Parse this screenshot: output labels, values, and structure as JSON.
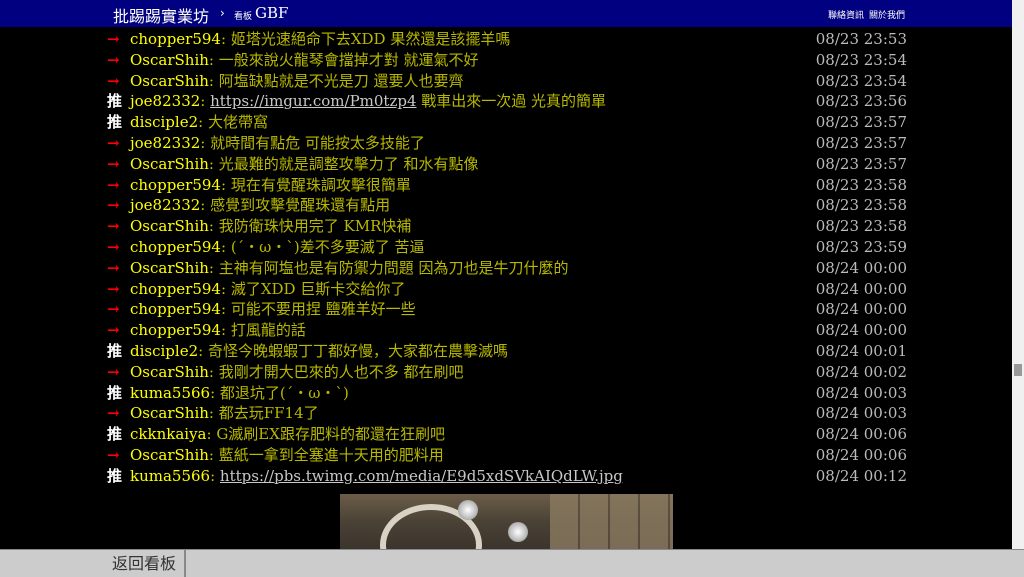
{
  "header": {
    "site_title": "批踢踢實業坊",
    "separator": "›",
    "board_prefix": "看板",
    "board_name": "GBF",
    "contact_link": "聯絡資訊",
    "about_link": "關於我們"
  },
  "pushes": [
    {
      "tag": "→",
      "type": "arrow",
      "user": "chopper594",
      "content": "姬塔光速絕命下去XDD 果然還是該擺羊嗎",
      "time": "08/23 23:53"
    },
    {
      "tag": "→",
      "type": "arrow",
      "user": "OscarShih",
      "content": "一般來說火龍琴會擋掉才對 就運氣不好",
      "time": "08/23 23:54"
    },
    {
      "tag": "→",
      "type": "arrow",
      "user": "OscarShih",
      "content": "阿塩缺點就是不光是刀 還要人也要齊",
      "time": "08/23 23:54"
    },
    {
      "tag": "推",
      "type": "push",
      "user": "joe82332",
      "link": "https://imgur.com/Pm0tzp4",
      "content": " 戰車出來一次過 光真的簡單",
      "time": "08/23 23:56"
    },
    {
      "tag": "推",
      "type": "push",
      "user": "disciple2",
      "content": "大佬帶窩",
      "time": "08/23 23:57"
    },
    {
      "tag": "→",
      "type": "arrow",
      "user": "joe82332",
      "content": "就時間有點危 可能按太多技能了",
      "time": "08/23 23:57"
    },
    {
      "tag": "→",
      "type": "arrow",
      "user": "OscarShih",
      "content": "光最難的就是調整攻擊力了 和水有點像",
      "time": "08/23 23:57"
    },
    {
      "tag": "→",
      "type": "arrow",
      "user": "chopper594",
      "content": "現在有覺醒珠調攻擊很簡單",
      "time": "08/23 23:58"
    },
    {
      "tag": "→",
      "type": "arrow",
      "user": "joe82332",
      "content": "感覺到攻擊覺醒珠還有點用",
      "time": "08/23 23:58"
    },
    {
      "tag": "→",
      "type": "arrow",
      "user": "OscarShih",
      "content": "我防衛珠快用完了 KMR快補",
      "time": "08/23 23:58"
    },
    {
      "tag": "→",
      "type": "arrow",
      "user": "chopper594",
      "content": "(´・ω・`)差不多要滅了  苦逼",
      "time": "08/23 23:59"
    },
    {
      "tag": "→",
      "type": "arrow",
      "user": "OscarShih",
      "content": "主神有阿塩也是有防禦力問題 因為刀也是牛刀什麼的",
      "time": "08/24 00:00"
    },
    {
      "tag": "→",
      "type": "arrow",
      "user": "chopper594",
      "content": "滅了XDD 巨斯卡交給你了",
      "time": "08/24 00:00"
    },
    {
      "tag": "→",
      "type": "arrow",
      "user": "chopper594",
      "content": "可能不要用捏  鹽雅羊好一些",
      "time": "08/24 00:00"
    },
    {
      "tag": "→",
      "type": "arrow",
      "user": "chopper594",
      "content": "打風龍的話",
      "time": "08/24 00:00"
    },
    {
      "tag": "推",
      "type": "push",
      "user": "disciple2",
      "content": "奇怪今晚蝦蝦丁丁都好慢，大家都在農擊滅嗎",
      "time": "08/24 00:01"
    },
    {
      "tag": "→",
      "type": "arrow",
      "user": "OscarShih",
      "content": "我剛才開大巴來的人也不多 都在刷吧",
      "time": "08/24 00:02"
    },
    {
      "tag": "推",
      "type": "push",
      "user": "kuma5566",
      "content": "都退坑了(´・ω・`)",
      "time": "08/24 00:03"
    },
    {
      "tag": "→",
      "type": "arrow",
      "user": "OscarShih",
      "content": "都去玩FF14了",
      "time": "08/24 00:03"
    },
    {
      "tag": "推",
      "type": "push",
      "user": "ckknkaiya",
      "content": "G滅刷EX跟存肥料的都還在狂刷吧",
      "time": "08/24 00:06"
    },
    {
      "tag": "→",
      "type": "arrow",
      "user": "OscarShih",
      "content": "藍紙一拿到全塞進十天用的肥料用",
      "time": "08/24 00:06"
    },
    {
      "tag": "推",
      "type": "push",
      "user": "kuma5566",
      "link": "https://pbs.twimg.com/media/E9d5xdSVkAIQdLW.jpg",
      "content": "",
      "time": "08/24 00:12"
    }
  ],
  "footer": {
    "back_label": "返回看板"
  },
  "colors": {
    "header_bg": "#000080",
    "push_user": "#ffff00",
    "push_content": "#b8b800",
    "arrow_tag": "#ff0000",
    "push_tag": "#ffffff"
  }
}
